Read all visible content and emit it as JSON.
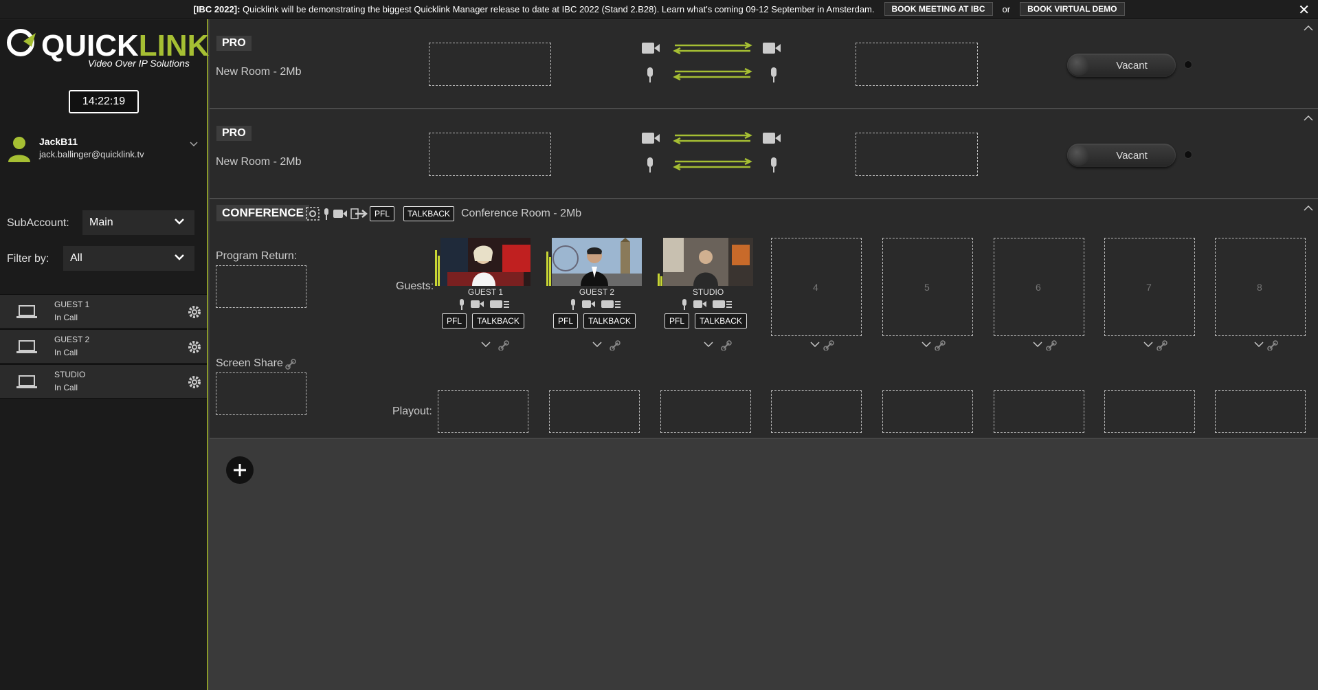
{
  "banner": {
    "prefix": "[IBC 2022]:",
    "text": "Quicklink will be demonstrating the biggest Quicklink Manager release to date at IBC 2022 (Stand 2.B28). Learn what's coming 09-12 September in Amsterdam.",
    "btn_meeting": "BOOK MEETING AT IBC",
    "or": "or",
    "btn_demo": "BOOK VIRTUAL DEMO",
    "close": "✕"
  },
  "brand": {
    "logo_main": "QUICK",
    "logo_accent": "LINK",
    "tagline": "Video Over IP Solutions",
    "accent": "#a6bf33"
  },
  "clock": "14:22:19",
  "user": {
    "name": "JackB11",
    "email": "jack.ballinger@quicklink.tv"
  },
  "subaccount": {
    "label": "SubAccount:",
    "value": "Main"
  },
  "filter": {
    "label": "Filter by:",
    "value": "All"
  },
  "devices": [
    {
      "name": "GUEST 1",
      "status": "In Call"
    },
    {
      "name": "GUEST 2",
      "status": "In Call"
    },
    {
      "name": "STUDIO",
      "status": "In Call"
    }
  ],
  "rooms": [
    {
      "badge": "PRO",
      "name": "New Room - 2Mb",
      "vacant": "Vacant"
    },
    {
      "badge": "PRO",
      "name": "New Room - 2Mb",
      "vacant": "Vacant"
    }
  ],
  "conference": {
    "badge": "CONFERENCE",
    "pfl": "PFL",
    "talkback": "TALKBACK",
    "name": "Conference Room - 2Mb",
    "program_return": "Program Return:",
    "screen_share": "Screen Share",
    "guests_label": "Guests:",
    "playout_label": "Playout:",
    "guests": [
      {
        "label": "GUEST 1",
        "pfl": "PFL",
        "talkback": "TALKBACK"
      },
      {
        "label": "GUEST 2",
        "pfl": "PFL",
        "talkback": "TALKBACK"
      },
      {
        "label": "STUDIO",
        "pfl": "PFL",
        "talkback": "TALKBACK"
      }
    ],
    "empty_slots": [
      "4",
      "5",
      "6",
      "7",
      "8"
    ]
  }
}
